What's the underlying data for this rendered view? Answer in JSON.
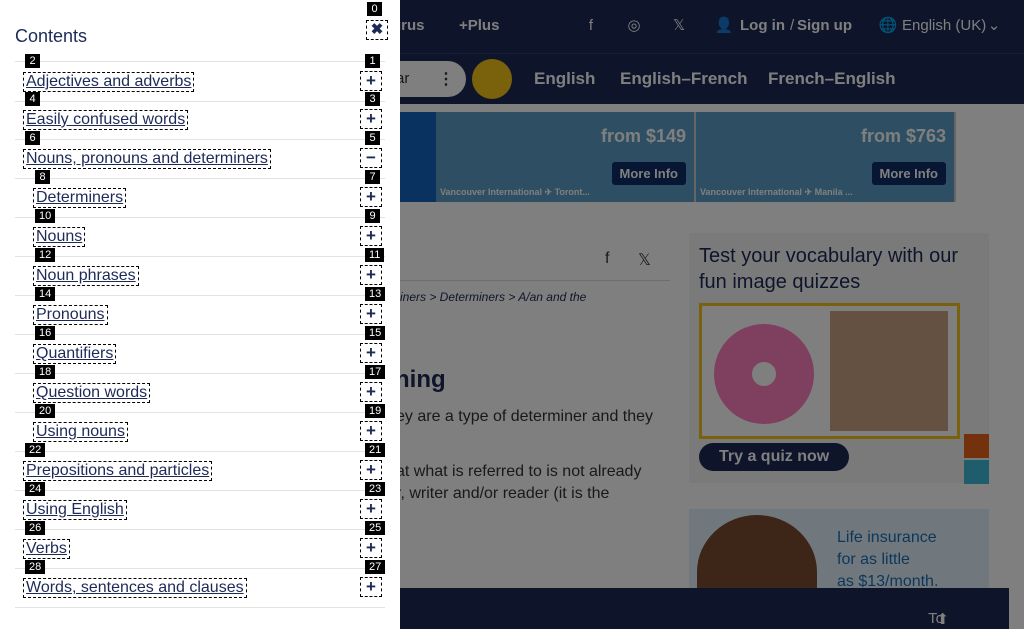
{
  "header": {
    "thesaurus_label": "urus",
    "plus_label": "+Plus",
    "login_label": "Log in",
    "login_separator": "/",
    "signup_label": "Sign up",
    "language_label": "English (UK)"
  },
  "nav": {
    "search_fragment": "ar",
    "links": [
      "English",
      "English–French",
      "French–English"
    ]
  },
  "ad_banner": {
    "panels": [
      {
        "price": "from $149",
        "button": "More Info",
        "caption": "Vancouver International ✈ Toront..."
      },
      {
        "price": "from $763",
        "button": "More Info",
        "caption": "Vancouver International ✈ Manila ..."
      }
    ]
  },
  "article": {
    "breadcrumb_tail": "rminers > Determiners > A/an and the",
    "heading_fragment": "ning",
    "para1_line1": "ey are a type of determiner and they",
    "para2_line1": "at what is referred to is not already",
    "para2_line2": "r, writer and/or reader (it is the"
  },
  "quiz": {
    "title": "Test your vocabulary with our fun image quizzes",
    "button": "Try a quiz now"
  },
  "ad2": {
    "text_line1": "Life insurance",
    "text_line2": "for as little",
    "text_line3": "as $13/month."
  },
  "footer": {
    "to_top_label": "To top"
  },
  "drawer": {
    "title": "Contents",
    "close_badge": "0",
    "close_symbol": "✖",
    "items": [
      {
        "label": "Adjectives and adverbs",
        "link_badge": "2",
        "toggle_badge": "1",
        "toggle": "+",
        "indent": 0
      },
      {
        "label": "Easily confused words",
        "link_badge": "4",
        "toggle_badge": "3",
        "toggle": "+",
        "indent": 0
      },
      {
        "label": "Nouns, pronouns and determiners",
        "link_badge": "6",
        "toggle_badge": "5",
        "toggle": "−",
        "indent": 0
      },
      {
        "label": "Determiners",
        "link_badge": "8",
        "toggle_badge": "7",
        "toggle": "+",
        "indent": 1
      },
      {
        "label": "Nouns",
        "link_badge": "10",
        "toggle_badge": "9",
        "toggle": "+",
        "indent": 1
      },
      {
        "label": "Noun phrases",
        "link_badge": "12",
        "toggle_badge": "11",
        "toggle": "+",
        "indent": 1
      },
      {
        "label": "Pronouns",
        "link_badge": "14",
        "toggle_badge": "13",
        "toggle": "+",
        "indent": 1
      },
      {
        "label": "Quantifiers",
        "link_badge": "16",
        "toggle_badge": "15",
        "toggle": "+",
        "indent": 1
      },
      {
        "label": "Question words",
        "link_badge": "18",
        "toggle_badge": "17",
        "toggle": "+",
        "indent": 1
      },
      {
        "label": "Using nouns",
        "link_badge": "20",
        "toggle_badge": "19",
        "toggle": "+",
        "indent": 1
      },
      {
        "label": "Prepositions and particles",
        "link_badge": "22",
        "toggle_badge": "21",
        "toggle": "+",
        "indent": 0
      },
      {
        "label": "Using English",
        "link_badge": "24",
        "toggle_badge": "23",
        "toggle": "+",
        "indent": 0
      },
      {
        "label": "Verbs",
        "link_badge": "26",
        "toggle_badge": "25",
        "toggle": "+",
        "indent": 0
      },
      {
        "label": "Words, sentences and clauses",
        "link_badge": "28",
        "toggle_badge": "27",
        "toggle": "+",
        "indent": 0
      }
    ]
  }
}
